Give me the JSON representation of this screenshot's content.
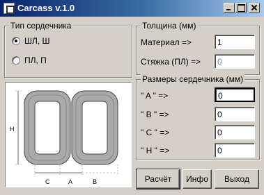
{
  "window": {
    "title": "Carcass v.1.0"
  },
  "core_type": {
    "legend": "Тип сердечника",
    "options": [
      {
        "label": "ШЛ, Ш",
        "checked": true
      },
      {
        "label": "ПЛ, П",
        "checked": false
      }
    ]
  },
  "thickness": {
    "legend": "Толщина (мм)",
    "material_label": "Материал =>",
    "material_value": "1",
    "clamp_label": "Стяжка (ПЛ) =>",
    "clamp_value": "0"
  },
  "dimensions": {
    "legend": "Размеры сердечника (мм)",
    "rows": [
      {
        "label": "\" A \"   =>",
        "value": "0"
      },
      {
        "label": "\" B \"   =>",
        "value": "0"
      },
      {
        "label": "\" C \"   =>",
        "value": "0"
      },
      {
        "label": "\" H \"   =>",
        "value": "0"
      }
    ]
  },
  "diagram": {
    "labels": {
      "h": "H",
      "c": "C",
      "a": "A",
      "b": "B"
    }
  },
  "buttons": {
    "calculate": "Расчёт",
    "info": "Инфо",
    "exit": "Выход"
  }
}
